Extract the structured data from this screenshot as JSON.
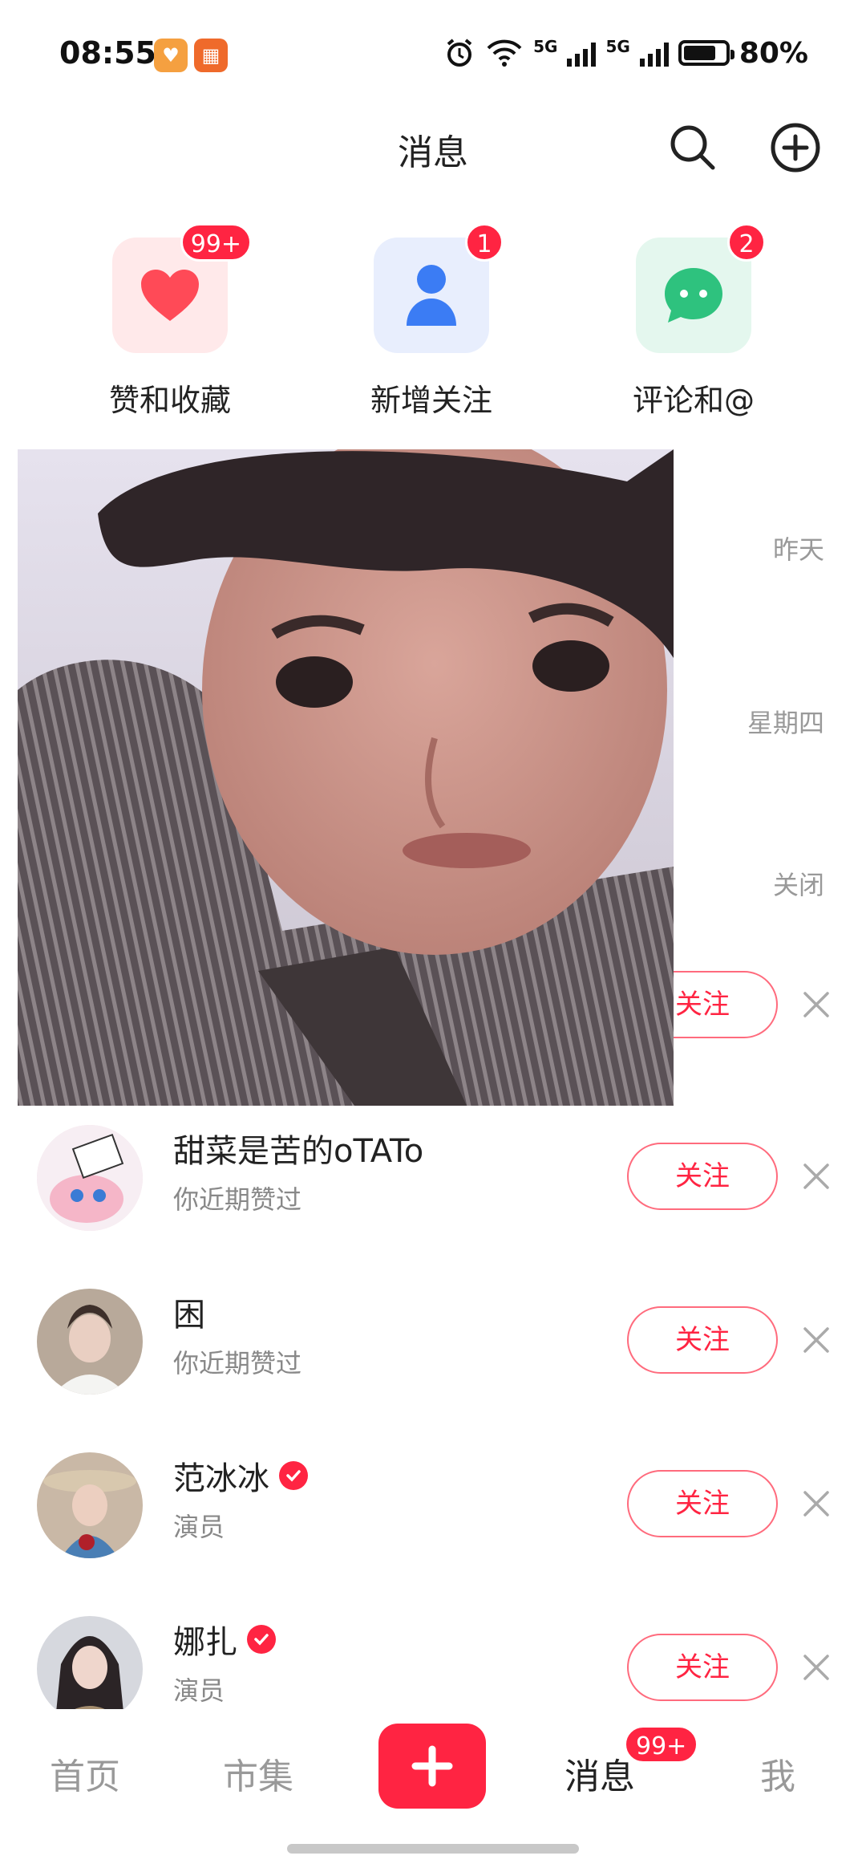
{
  "status_bar": {
    "time": "08:55",
    "network_1": "5G",
    "network_2": "5G",
    "battery": "80%"
  },
  "header": {
    "title": "消息"
  },
  "categories": [
    {
      "label": "赞和收藏",
      "badge": "99+"
    },
    {
      "label": "新增关注",
      "badge": "1"
    },
    {
      "label": "评论和@",
      "badge": "2"
    }
  ],
  "messages": {
    "time_1": "昨天",
    "time_2": "星期四",
    "close_label": "关闭"
  },
  "suggestions": {
    "follow_label": "关注",
    "items": [
      {
        "name": "",
        "subtitle": ""
      },
      {
        "name": "甜菜是苦的oTATo",
        "subtitle": "你近期赞过"
      },
      {
        "name": "困",
        "subtitle": "你近期赞过"
      },
      {
        "name": "范冰冰",
        "subtitle": "演员"
      },
      {
        "name": "娜扎",
        "subtitle": "演员"
      }
    ]
  },
  "bottom_nav": {
    "home": "首页",
    "market": "市集",
    "messages": "消息",
    "messages_badge": "99+",
    "me": "我"
  },
  "colors": {
    "accent": "#ff2442"
  }
}
